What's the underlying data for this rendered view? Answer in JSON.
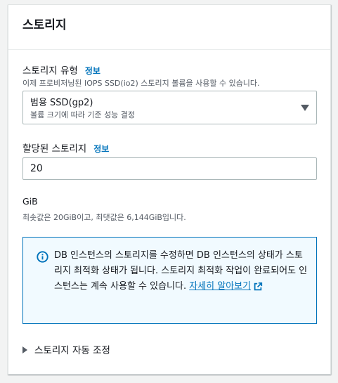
{
  "panel": {
    "title": "스토리지"
  },
  "storage_type": {
    "label": "스토리지 유형",
    "info_link": "정보",
    "description": "이제 프로비저닝된 IOPS SSD(io2) 스토리지 볼륨을 사용할 수 있습니다.",
    "selected_value": "범용 SSD(gp2)",
    "selected_description": "볼륨 크기에 따라 기준 성능 결정"
  },
  "allocated_storage": {
    "label": "할당된 스토리지",
    "info_link": "정보",
    "value": "20",
    "unit": "GiB",
    "constraint": "최솟값은 20GiB이고, 최댓값은 6,144GiB입니다."
  },
  "alert": {
    "text": "DB 인스턴스의 스토리지를 수정하면 DB 인스턴스의 상태가 스토리지 최적화 상태가 됩니다. 스토리지 최적화 작업이 완료되어도 인스턴스는 계속 사용할 수 있습니다. ",
    "link_text": "자세히 알아보기",
    "accent_color": "#0073bb",
    "background_color": "#f1faff"
  },
  "autoscaling": {
    "label": "스토리지 자동 조정"
  }
}
